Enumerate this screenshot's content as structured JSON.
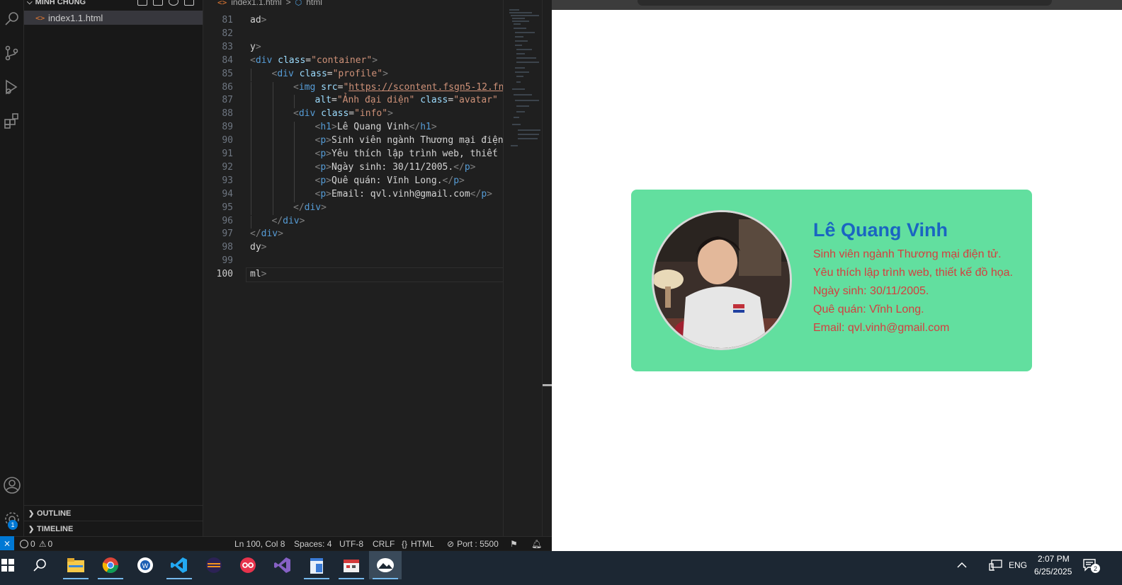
{
  "vscode": {
    "explorer": {
      "folder_label": "MINH CHUNG",
      "file": "index1.1.html",
      "sections": [
        {
          "label": "OUTLINE"
        },
        {
          "label": "TIMELINE"
        }
      ]
    },
    "breadcrumb": {
      "file": "index1.1.html",
      "symbol": "html"
    },
    "code": {
      "line_numbers": [
        "81",
        "82",
        "83",
        "84",
        "85",
        "86",
        "87",
        "88",
        "89",
        "90",
        "91",
        "92",
        "93",
        "94",
        "95",
        "96",
        "97",
        "98",
        "99",
        "100"
      ],
      "lines": [
        {
          "n": "81",
          "indent": 0,
          "parts": [
            [
              "txt",
              "ad"
            ],
            [
              "br",
              ">"
            ]
          ]
        },
        {
          "n": "82",
          "indent": 0,
          "parts": []
        },
        {
          "n": "83",
          "indent": 0,
          "parts": [
            [
              "txt",
              "y"
            ],
            [
              "br",
              ">"
            ]
          ]
        },
        {
          "n": "84",
          "indent": 0,
          "parts": [
            [
              "br",
              "<"
            ],
            [
              "tag",
              "div"
            ],
            [
              "txt",
              " "
            ],
            [
              "attr",
              "class"
            ],
            [
              "txt",
              "="
            ],
            [
              "str",
              "\"container\""
            ],
            [
              "br",
              ">"
            ]
          ]
        },
        {
          "n": "85",
          "indent": 1,
          "parts": [
            [
              "br",
              "<"
            ],
            [
              "tag",
              "div"
            ],
            [
              "txt",
              " "
            ],
            [
              "attr",
              "class"
            ],
            [
              "txt",
              "="
            ],
            [
              "str",
              "\"profile\""
            ],
            [
              "br",
              ">"
            ]
          ]
        },
        {
          "n": "86",
          "indent": 2,
          "parts": [
            [
              "br",
              "<"
            ],
            [
              "tag",
              "img"
            ],
            [
              "txt",
              " "
            ],
            [
              "attr",
              "src"
            ],
            [
              "txt",
              "="
            ],
            [
              "str",
              "\""
            ],
            [
              "url",
              "https://scontent.fsgn5-12.fna"
            ]
          ]
        },
        {
          "n": "87",
          "indent": 3,
          "parts": [
            [
              "attr",
              "alt"
            ],
            [
              "txt",
              "="
            ],
            [
              "str",
              "\"Ảnh đại diện\""
            ],
            [
              "txt",
              " "
            ],
            [
              "attr",
              "class"
            ],
            [
              "txt",
              "="
            ],
            [
              "str",
              "\"avatar\""
            ],
            [
              "txt",
              " "
            ],
            [
              "br",
              "/"
            ]
          ]
        },
        {
          "n": "88",
          "indent": 2,
          "parts": [
            [
              "br",
              "<"
            ],
            [
              "tag",
              "div"
            ],
            [
              "txt",
              " "
            ],
            [
              "attr",
              "class"
            ],
            [
              "txt",
              "="
            ],
            [
              "str",
              "\"info\""
            ],
            [
              "br",
              ">"
            ]
          ]
        },
        {
          "n": "89",
          "indent": 3,
          "parts": [
            [
              "br",
              "<"
            ],
            [
              "tag",
              "h1"
            ],
            [
              "br",
              ">"
            ],
            [
              "txt",
              "Lê Quang Vinh"
            ],
            [
              "br",
              "</"
            ],
            [
              "tag",
              "h1"
            ],
            [
              "br",
              ">"
            ]
          ]
        },
        {
          "n": "90",
          "indent": 3,
          "parts": [
            [
              "br",
              "<"
            ],
            [
              "tag",
              "p"
            ],
            [
              "br",
              ">"
            ],
            [
              "txt",
              "Sinh viên ngành Thương mại điện"
            ]
          ]
        },
        {
          "n": "91",
          "indent": 3,
          "parts": [
            [
              "br",
              "<"
            ],
            [
              "tag",
              "p"
            ],
            [
              "br",
              ">"
            ],
            [
              "txt",
              "Yêu thích lập trình web, thiết k"
            ]
          ]
        },
        {
          "n": "92",
          "indent": 3,
          "parts": [
            [
              "br",
              "<"
            ],
            [
              "tag",
              "p"
            ],
            [
              "br",
              ">"
            ],
            [
              "txt",
              "Ngày sinh: 30/11/2005."
            ],
            [
              "br",
              "</"
            ],
            [
              "tag",
              "p"
            ],
            [
              "br",
              ">"
            ]
          ]
        },
        {
          "n": "93",
          "indent": 3,
          "parts": [
            [
              "br",
              "<"
            ],
            [
              "tag",
              "p"
            ],
            [
              "br",
              ">"
            ],
            [
              "txt",
              "Quê quán: Vĩnh Long."
            ],
            [
              "br",
              "</"
            ],
            [
              "tag",
              "p"
            ],
            [
              "br",
              ">"
            ]
          ]
        },
        {
          "n": "94",
          "indent": 3,
          "parts": [
            [
              "br",
              "<"
            ],
            [
              "tag",
              "p"
            ],
            [
              "br",
              ">"
            ],
            [
              "txt",
              "Email: qvl.vinh@gmail.com"
            ],
            [
              "br",
              "</"
            ],
            [
              "tag",
              "p"
            ],
            [
              "br",
              ">"
            ]
          ]
        },
        {
          "n": "95",
          "indent": 2,
          "parts": [
            [
              "br",
              "</"
            ],
            [
              "tag",
              "div"
            ],
            [
              "br",
              ">"
            ]
          ]
        },
        {
          "n": "96",
          "indent": 1,
          "parts": [
            [
              "br",
              "</"
            ],
            [
              "tag",
              "div"
            ],
            [
              "br",
              ">"
            ]
          ]
        },
        {
          "n": "97",
          "indent": 0,
          "parts": [
            [
              "br",
              "</"
            ],
            [
              "tag",
              "div"
            ],
            [
              "br",
              ">"
            ]
          ]
        },
        {
          "n": "98",
          "indent": 0,
          "parts": [
            [
              "txt",
              "dy"
            ],
            [
              "br",
              ">"
            ]
          ]
        },
        {
          "n": "99",
          "indent": 0,
          "parts": []
        },
        {
          "n": "100",
          "indent": 0,
          "parts": [
            [
              "txt",
              "ml"
            ],
            [
              "br",
              ">"
            ]
          ]
        }
      ]
    },
    "status": {
      "errors": "0",
      "warnings": "0",
      "position": "Ln 100, Col 8",
      "spaces": "Spaces: 4",
      "encoding": "UTF-8",
      "eol": "CRLF",
      "language": "HTML",
      "port": "Port : 5500"
    },
    "settings_badge": "1"
  },
  "preview": {
    "name": "Lê Quang Vinh",
    "lines": [
      "Sinh viên ngành Thương mại điện tử.",
      "Yêu thích lập trình web, thiết kế đồ họa.",
      "Ngày sinh: 30/11/2005.",
      "Quê quán: Vĩnh Long.",
      "Email: qvl.vinh@gmail.com"
    ],
    "card_color": "#62df9f",
    "name_color": "#1a65c2",
    "text_color": "#d43f3f"
  },
  "taskbar": {
    "language": "ENG",
    "time": "2:07 PM",
    "date": "6/25/2025",
    "notification_count": "2",
    "apps": [
      "file-explorer-icon",
      "chrome-icon",
      "app-w-icon",
      "vscode-icon",
      "eclipse-icon",
      "app-oo-icon",
      "visual-studio-icon",
      "notepad-icon",
      "app-calendar-icon",
      "app-photos-icon"
    ]
  }
}
